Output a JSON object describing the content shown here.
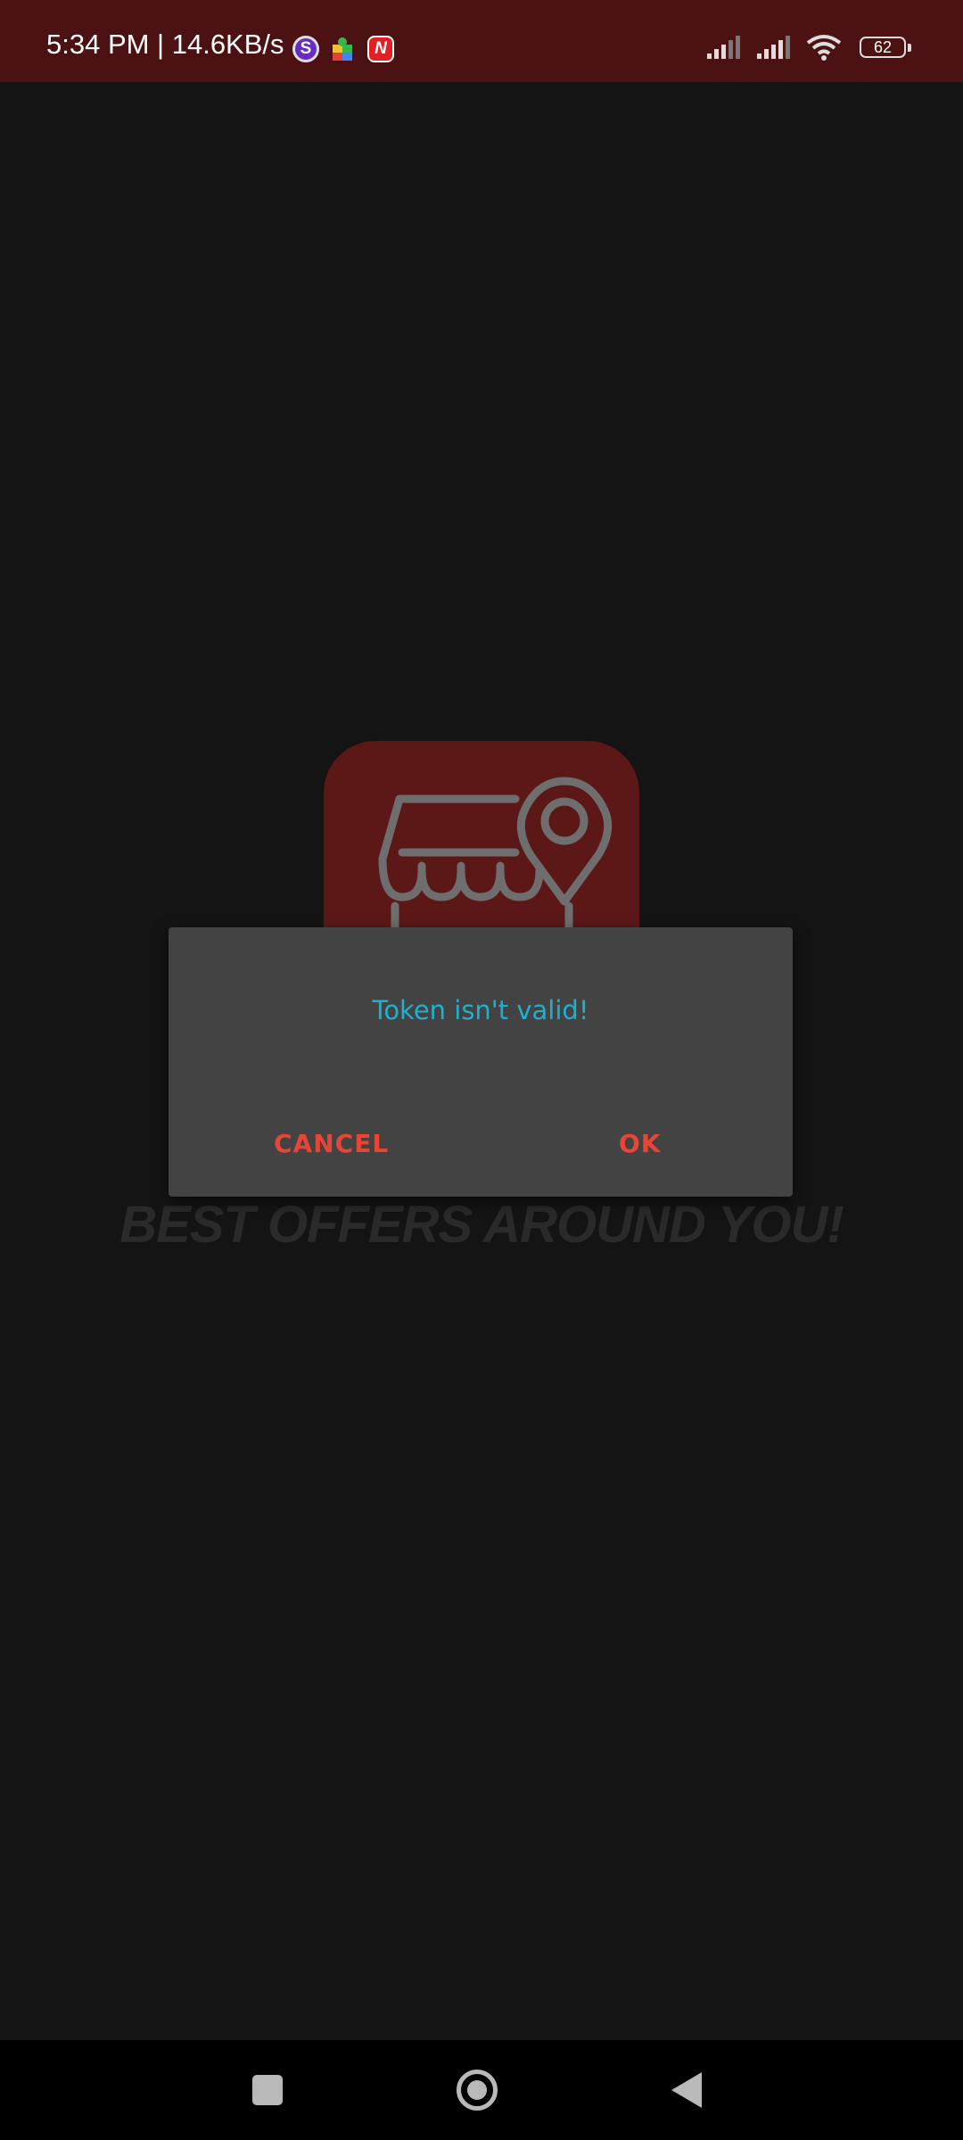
{
  "status_bar": {
    "time": "5:34 PM | 14.6KB/s",
    "notification_icons": [
      "s-app-icon",
      "puzzle-app-icon",
      "n-app-icon"
    ],
    "s_icon_letter": "S",
    "n_icon_letter": "N",
    "battery_level": "62",
    "signal_icons": [
      "signal-sim1-icon",
      "signal-sim2-icon",
      "wifi-icon"
    ]
  },
  "background": {
    "logo": "store-location-logo",
    "tagline": "BEST OFFERS AROUND YOU!"
  },
  "dialog": {
    "message": "Token isn't valid!",
    "cancel_label": "CANCEL",
    "ok_label": "OK"
  },
  "nav_bar": {
    "buttons": [
      "recents-button",
      "home-button",
      "back-button"
    ]
  },
  "colors": {
    "status_bar": "#4c1113",
    "background": "#141414",
    "dialog": "#434343",
    "message": "#1fb0cf",
    "button_text": "#e74637",
    "logo_background": "#5c1817"
  }
}
